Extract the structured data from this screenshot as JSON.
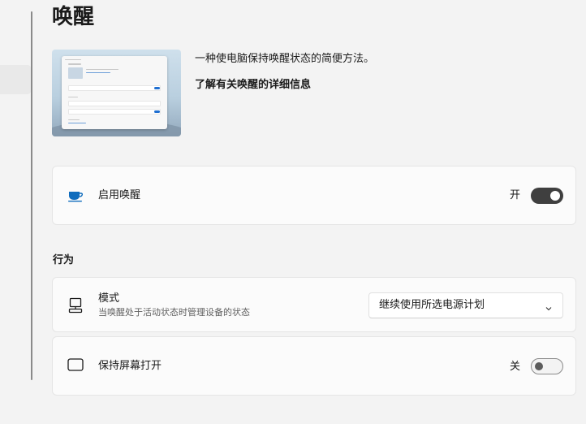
{
  "page": {
    "title": "唤醒"
  },
  "hero": {
    "image_name": "awake-preview",
    "description": "一种使电脑保持唤醒状态的简便方法。",
    "learn_more": "了解有关唤醒的详细信息"
  },
  "enable": {
    "label": "启用唤醒",
    "icon": "coffee-cup-icon",
    "state_text": "开",
    "on": true
  },
  "behavior": {
    "title": "行为",
    "mode": {
      "label": "模式",
      "description": "当唤醒处于活动状态时管理设备的状态",
      "icon": "computer-icon",
      "selected": "继续使用所选电源计划"
    },
    "keep_screen_on": {
      "label": "保持屏幕打开",
      "icon": "screen-icon",
      "state_text": "关",
      "on": false
    }
  },
  "colors": {
    "background": "#f3f3f3",
    "card": "#fbfbfb",
    "toggle_on": "#3f3f3f",
    "icon_accent": "#0f6cbd"
  }
}
